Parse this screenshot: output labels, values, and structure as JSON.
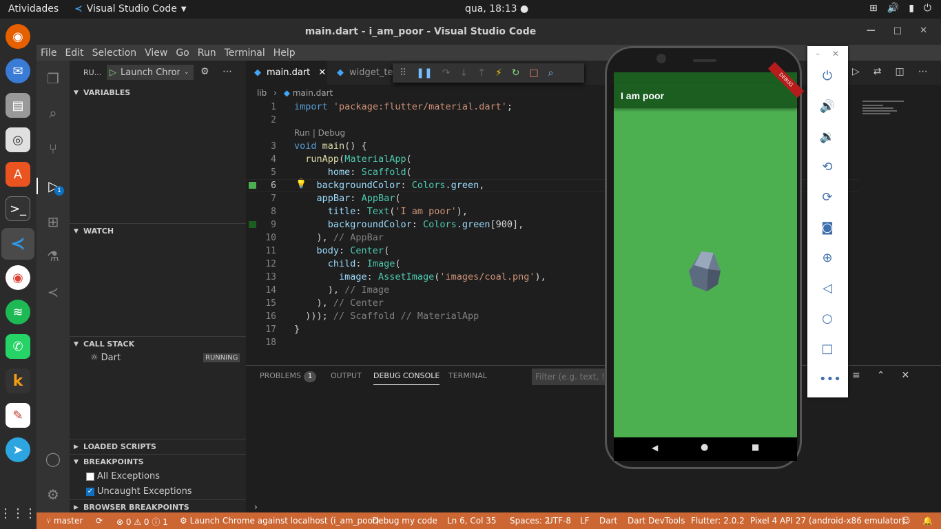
{
  "topbar": {
    "activities": "Atividades",
    "app_name": "Visual Studio Code",
    "clock": "qua, 18:13 ●"
  },
  "window": {
    "title": "main.dart - i_am_poor - Visual Studio Code"
  },
  "menu": [
    "File",
    "Edit",
    "Selection",
    "View",
    "Go",
    "Run",
    "Terminal",
    "Help"
  ],
  "run_panel": {
    "title": "RU...",
    "launch_config": "Launch Chrom",
    "sections": {
      "variables": "VARIABLES",
      "watch": "WATCH",
      "call_stack": "CALL STACK",
      "loaded_scripts": "LOADED SCRIPTS",
      "breakpoints": "BREAKPOINTS",
      "browser_breakpoints": "BROWSER BREAKPOINTS"
    },
    "call_stack_item": "Dart",
    "call_stack_status": "RUNNING",
    "breakpoint_items": [
      "All Exceptions",
      "Uncaught Exceptions"
    ],
    "debug_badge": "1"
  },
  "tabs": [
    "main.dart",
    "widget_te"
  ],
  "breadcrumbs": [
    "lib",
    "main.dart"
  ],
  "codelens": "Run | Debug",
  "code_lines": [
    {
      "n": "1",
      "t": "import 'package:flutter/material.dart';"
    },
    {
      "n": "2",
      "t": ""
    },
    {
      "n": "3",
      "t": "void main() {"
    },
    {
      "n": "4",
      "t": "  runApp(MaterialApp("
    },
    {
      "n": "5",
      "t": "      home: Scaffold("
    },
    {
      "n": "6",
      "t": "    backgroundColor: Colors.green,"
    },
    {
      "n": "7",
      "t": "    appBar: AppBar("
    },
    {
      "n": "8",
      "t": "      title: Text('I am poor'),"
    },
    {
      "n": "9",
      "t": "      backgroundColor: Colors.green[900],"
    },
    {
      "n": "10",
      "t": "    ), // AppBar"
    },
    {
      "n": "11",
      "t": "    body: Center("
    },
    {
      "n": "12",
      "t": "      child: Image("
    },
    {
      "n": "13",
      "t": "        image: AssetImage('images/coal.png'),"
    },
    {
      "n": "14",
      "t": "      ), // Image"
    },
    {
      "n": "15",
      "t": "    ), // Center"
    },
    {
      "n": "16",
      "t": "  ))); // Scaffold // MaterialApp"
    },
    {
      "n": "17",
      "t": "}"
    },
    {
      "n": "18",
      "t": ""
    }
  ],
  "panel": {
    "tabs": [
      "PROBLEMS",
      "OUTPUT",
      "DEBUG CONSOLE",
      "TERMINAL"
    ],
    "problems_count": "1",
    "filter_placeholder": "Filter (e.g. text, !ex"
  },
  "status": {
    "branch": "master",
    "errors": "⊗ 0 ⚠ 0 ⓘ 1",
    "launch": "Launch Chrome against localhost (i_am_poor)",
    "debug_my_code": "Debug my code",
    "position": "Ln 6, Col 35",
    "spaces": "Spaces: 2",
    "encoding": "UTF-8",
    "eol": "LF",
    "language": "Dart",
    "devtools": "Dart DevTools",
    "flutter": "Flutter: 2.0.2",
    "device": "Pixel 4 API 27 (android-x86 emulator)"
  },
  "emulator": {
    "appbar_title": "I am poor",
    "debug_ribbon": "DEBUG"
  },
  "colors": {
    "status_bar": "#cc6633",
    "green": "#4caf50",
    "green900": "#1b5e20"
  }
}
